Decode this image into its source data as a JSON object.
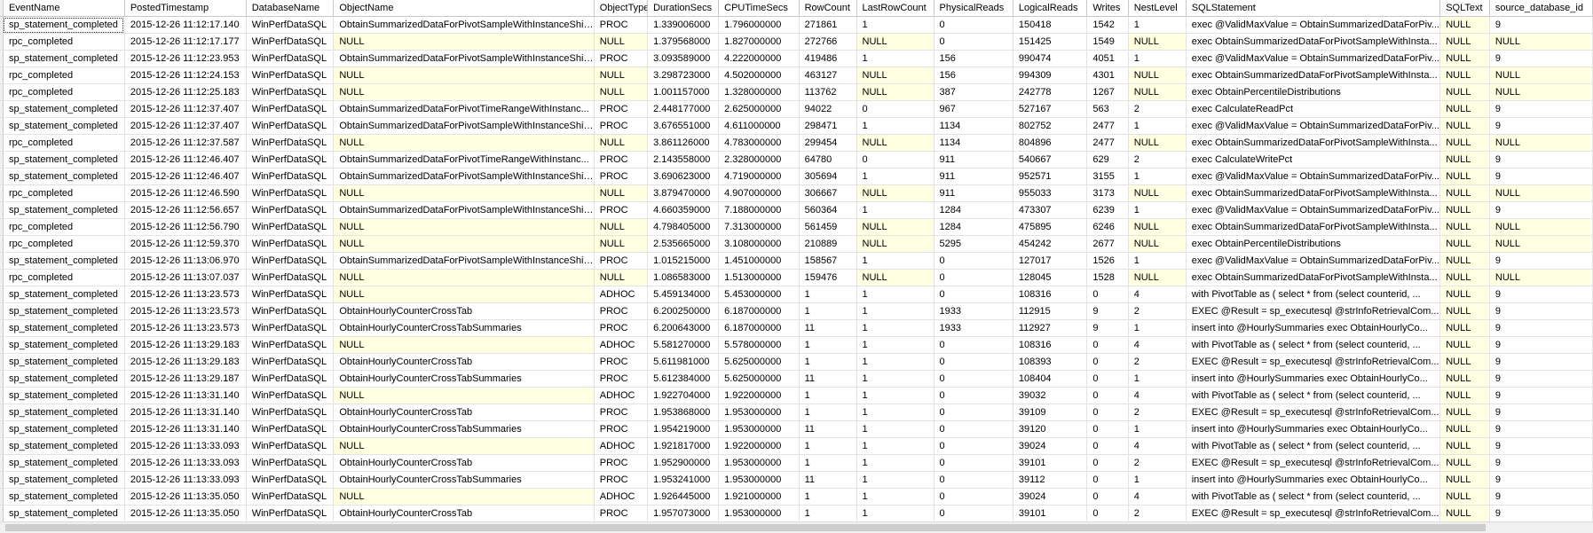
{
  "columns": [
    "",
    "EventName",
    "PostedTimestamp",
    "DatabaseName",
    "ObjectName",
    "ObjectType",
    "DurationSecs",
    "CPUTimeSecs",
    "RowCount",
    "LastRowCount",
    "PhysicalReads",
    "LogicalReads",
    "Writes",
    "NestLevel",
    "SQLStatement",
    "SQLText",
    "source_database_id"
  ],
  "rows": [
    [
      "sp_statement_completed",
      "2015-12-26 11:12:17.140",
      "WinPerfDataSQL",
      "ObtainSummarizedDataForPivotSampleWithInstanceShif...",
      "PROC",
      "1.339006000",
      "1.796000000",
      "271861",
      "1",
      "0",
      "150418",
      "1542",
      "1",
      "exec @ValidMaxValue = ObtainSummarizedDataForPiv...",
      "NULL",
      "9"
    ],
    [
      "rpc_completed",
      "2015-12-26 11:12:17.177",
      "WinPerfDataSQL",
      "NULL",
      "NULL",
      "1.379568000",
      "1.827000000",
      "272766",
      "NULL",
      "0",
      "151425",
      "1549",
      "NULL",
      "exec ObtainSummarizedDataForPivotSampleWithInsta...",
      "NULL",
      "NULL"
    ],
    [
      "sp_statement_completed",
      "2015-12-26 11:12:23.953",
      "WinPerfDataSQL",
      "ObtainSummarizedDataForPivotSampleWithInstanceShif...",
      "PROC",
      "3.093589000",
      "4.222000000",
      "419486",
      "1",
      "156",
      "990474",
      "4051",
      "1",
      "exec @ValidMaxValue = ObtainSummarizedDataForPiv...",
      "NULL",
      "9"
    ],
    [
      "rpc_completed",
      "2015-12-26 11:12:24.153",
      "WinPerfDataSQL",
      "NULL",
      "NULL",
      "3.298723000",
      "4.502000000",
      "463127",
      "NULL",
      "156",
      "994309",
      "4301",
      "NULL",
      "exec ObtainSummarizedDataForPivotSampleWithInsta...",
      "NULL",
      "NULL"
    ],
    [
      "rpc_completed",
      "2015-12-26 11:12:25.183",
      "WinPerfDataSQL",
      "NULL",
      "NULL",
      "1.001157000",
      "1.328000000",
      "113762",
      "NULL",
      "387",
      "242778",
      "1267",
      "NULL",
      "exec ObtainPercentileDistributions",
      "NULL",
      "NULL"
    ],
    [
      "sp_statement_completed",
      "2015-12-26 11:12:37.407",
      "WinPerfDataSQL",
      "ObtainSummarizedDataForPivotTimeRangeWithInstanc...",
      "PROC",
      "2.448177000",
      "2.625000000",
      "94022",
      "0",
      "967",
      "527167",
      "563",
      "2",
      "exec CalculateReadPct",
      "NULL",
      "9"
    ],
    [
      "sp_statement_completed",
      "2015-12-26 11:12:37.407",
      "WinPerfDataSQL",
      "ObtainSummarizedDataForPivotSampleWithInstanceShif...",
      "PROC",
      "3.676551000",
      "4.611000000",
      "298471",
      "1",
      "1134",
      "802752",
      "2477",
      "1",
      "exec @ValidMaxValue = ObtainSummarizedDataForPiv...",
      "NULL",
      "9"
    ],
    [
      "rpc_completed",
      "2015-12-26 11:12:37.587",
      "WinPerfDataSQL",
      "NULL",
      "NULL",
      "3.861126000",
      "4.783000000",
      "299454",
      "NULL",
      "1134",
      "804896",
      "2477",
      "NULL",
      "exec ObtainSummarizedDataForPivotSampleWithInsta...",
      "NULL",
      "NULL"
    ],
    [
      "sp_statement_completed",
      "2015-12-26 11:12:46.407",
      "WinPerfDataSQL",
      "ObtainSummarizedDataForPivotTimeRangeWithInstanc...",
      "PROC",
      "2.143558000",
      "2.328000000",
      "64780",
      "0",
      "911",
      "540667",
      "629",
      "2",
      "exec CalculateWritePct",
      "NULL",
      "9"
    ],
    [
      "sp_statement_completed",
      "2015-12-26 11:12:46.407",
      "WinPerfDataSQL",
      "ObtainSummarizedDataForPivotSampleWithInstanceShif...",
      "PROC",
      "3.690623000",
      "4.719000000",
      "305694",
      "1",
      "911",
      "952571",
      "3155",
      "1",
      "exec @ValidMaxValue = ObtainSummarizedDataForPiv...",
      "NULL",
      "9"
    ],
    [
      "rpc_completed",
      "2015-12-26 11:12:46.590",
      "WinPerfDataSQL",
      "NULL",
      "NULL",
      "3.879470000",
      "4.907000000",
      "306667",
      "NULL",
      "911",
      "955033",
      "3173",
      "NULL",
      "exec ObtainSummarizedDataForPivotSampleWithInsta...",
      "NULL",
      "NULL"
    ],
    [
      "sp_statement_completed",
      "2015-12-26 11:12:56.657",
      "WinPerfDataSQL",
      "ObtainSummarizedDataForPivotSampleWithInstanceShif...",
      "PROC",
      "4.660359000",
      "7.188000000",
      "560364",
      "1",
      "1284",
      "473307",
      "6239",
      "1",
      "exec @ValidMaxValue = ObtainSummarizedDataForPiv...",
      "NULL",
      "9"
    ],
    [
      "rpc_completed",
      "2015-12-26 11:12:56.790",
      "WinPerfDataSQL",
      "NULL",
      "NULL",
      "4.798405000",
      "7.313000000",
      "561459",
      "NULL",
      "1284",
      "475895",
      "6246",
      "NULL",
      "exec ObtainSummarizedDataForPivotSampleWithInsta...",
      "NULL",
      "NULL"
    ],
    [
      "rpc_completed",
      "2015-12-26 11:12:59.370",
      "WinPerfDataSQL",
      "NULL",
      "NULL",
      "2.535665000",
      "3.108000000",
      "210889",
      "NULL",
      "5295",
      "454242",
      "2677",
      "NULL",
      "exec ObtainPercentileDistributions",
      "NULL",
      "NULL"
    ],
    [
      "sp_statement_completed",
      "2015-12-26 11:13:06.970",
      "WinPerfDataSQL",
      "ObtainSummarizedDataForPivotSampleWithInstanceShif...",
      "PROC",
      "1.015215000",
      "1.451000000",
      "158567",
      "1",
      "0",
      "127017",
      "1526",
      "1",
      "exec @ValidMaxValue = ObtainSummarizedDataForPiv...",
      "NULL",
      "9"
    ],
    [
      "rpc_completed",
      "2015-12-26 11:13:07.037",
      "WinPerfDataSQL",
      "NULL",
      "NULL",
      "1.086583000",
      "1.513000000",
      "159476",
      "NULL",
      "0",
      "128045",
      "1528",
      "NULL",
      "exec ObtainSummarizedDataForPivotSampleWithInsta...",
      "NULL",
      "NULL"
    ],
    [
      "sp_statement_completed",
      "2015-12-26 11:13:23.573",
      "WinPerfDataSQL",
      "NULL",
      "ADHOC",
      "5.459134000",
      "5.453000000",
      "1",
      "1",
      "0",
      "108316",
      "0",
      "4",
      "with PivotTable as (   select *   from (select counterid, ...",
      "NULL",
      "9"
    ],
    [
      "sp_statement_completed",
      "2015-12-26 11:13:23.573",
      "WinPerfDataSQL",
      "ObtainHourlyCounterCrossTab",
      "PROC",
      "6.200250000",
      "6.187000000",
      "1",
      "1",
      "1933",
      "112915",
      "9",
      "2",
      "EXEC @Result = sp_executesql @strInfoRetrievalCom...",
      "NULL",
      "9"
    ],
    [
      "sp_statement_completed",
      "2015-12-26 11:13:23.573",
      "WinPerfDataSQL",
      "ObtainHourlyCounterCrossTabSummaries",
      "PROC",
      "6.200643000",
      "6.187000000",
      "11",
      "1",
      "1933",
      "112927",
      "9",
      "1",
      "insert into @HourlySummaries   exec ObtainHourlyCo...",
      "NULL",
      "9"
    ],
    [
      "sp_statement_completed",
      "2015-12-26 11:13:29.183",
      "WinPerfDataSQL",
      "NULL",
      "ADHOC",
      "5.581270000",
      "5.578000000",
      "1",
      "1",
      "0",
      "108316",
      "0",
      "4",
      "with PivotTable as (   select *   from (select counterid, ...",
      "NULL",
      "9"
    ],
    [
      "sp_statement_completed",
      "2015-12-26 11:13:29.183",
      "WinPerfDataSQL",
      "ObtainHourlyCounterCrossTab",
      "PROC",
      "5.611981000",
      "5.625000000",
      "1",
      "1",
      "0",
      "108393",
      "0",
      "2",
      "EXEC @Result = sp_executesql @strInfoRetrievalCom...",
      "NULL",
      "9"
    ],
    [
      "sp_statement_completed",
      "2015-12-26 11:13:29.187",
      "WinPerfDataSQL",
      "ObtainHourlyCounterCrossTabSummaries",
      "PROC",
      "5.612384000",
      "5.625000000",
      "11",
      "1",
      "0",
      "108404",
      "0",
      "1",
      "insert into @HourlySummaries   exec ObtainHourlyCo...",
      "NULL",
      "9"
    ],
    [
      "sp_statement_completed",
      "2015-12-26 11:13:31.140",
      "WinPerfDataSQL",
      "NULL",
      "ADHOC",
      "1.922704000",
      "1.922000000",
      "1",
      "1",
      "0",
      "39032",
      "0",
      "4",
      "with PivotTable as (   select *   from (select counterid, ...",
      "NULL",
      "9"
    ],
    [
      "sp_statement_completed",
      "2015-12-26 11:13:31.140",
      "WinPerfDataSQL",
      "ObtainHourlyCounterCrossTab",
      "PROC",
      "1.953868000",
      "1.953000000",
      "1",
      "1",
      "0",
      "39109",
      "0",
      "2",
      "EXEC @Result = sp_executesql @strInfoRetrievalCom...",
      "NULL",
      "9"
    ],
    [
      "sp_statement_completed",
      "2015-12-26 11:13:31.140",
      "WinPerfDataSQL",
      "ObtainHourlyCounterCrossTabSummaries",
      "PROC",
      "1.954219000",
      "1.953000000",
      "11",
      "1",
      "0",
      "39120",
      "0",
      "1",
      "insert into @HourlySummaries   exec ObtainHourlyCo...",
      "NULL",
      "9"
    ],
    [
      "sp_statement_completed",
      "2015-12-26 11:13:33.093",
      "WinPerfDataSQL",
      "NULL",
      "ADHOC",
      "1.921817000",
      "1.922000000",
      "1",
      "1",
      "0",
      "39024",
      "0",
      "4",
      "with PivotTable as (   select *   from (select counterid, ...",
      "NULL",
      "9"
    ],
    [
      "sp_statement_completed",
      "2015-12-26 11:13:33.093",
      "WinPerfDataSQL",
      "ObtainHourlyCounterCrossTab",
      "PROC",
      "1.952900000",
      "1.953000000",
      "1",
      "1",
      "0",
      "39101",
      "0",
      "2",
      "EXEC @Result = sp_executesql @strInfoRetrievalCom...",
      "NULL",
      "9"
    ],
    [
      "sp_statement_completed",
      "2015-12-26 11:13:33.093",
      "WinPerfDataSQL",
      "ObtainHourlyCounterCrossTabSummaries",
      "PROC",
      "1.953241000",
      "1.953000000",
      "11",
      "1",
      "0",
      "39112",
      "0",
      "1",
      "insert into @HourlySummaries   exec ObtainHourlyCo...",
      "NULL",
      "9"
    ],
    [
      "sp_statement_completed",
      "2015-12-26 11:13:35.050",
      "WinPerfDataSQL",
      "NULL",
      "ADHOC",
      "1.926445000",
      "1.921000000",
      "1",
      "1",
      "0",
      "39024",
      "0",
      "4",
      "with PivotTable as (   select *   from (select counterid, ...",
      "NULL",
      "9"
    ],
    [
      "sp_statement_completed",
      "2015-12-26 11:13:35.050",
      "WinPerfDataSQL",
      "ObtainHourlyCounterCrossTab",
      "PROC",
      "1.957073000",
      "1.953000000",
      "1",
      "1",
      "0",
      "39101",
      "0",
      "2",
      "EXEC @Result = sp_executesql @strInfoRetrievalCom...",
      "NULL",
      "9"
    ]
  ],
  "colors": {
    "null_cell": "#ffffe1",
    "grid_line": "#e3e3e3",
    "header_line": "#c9c9c9"
  }
}
